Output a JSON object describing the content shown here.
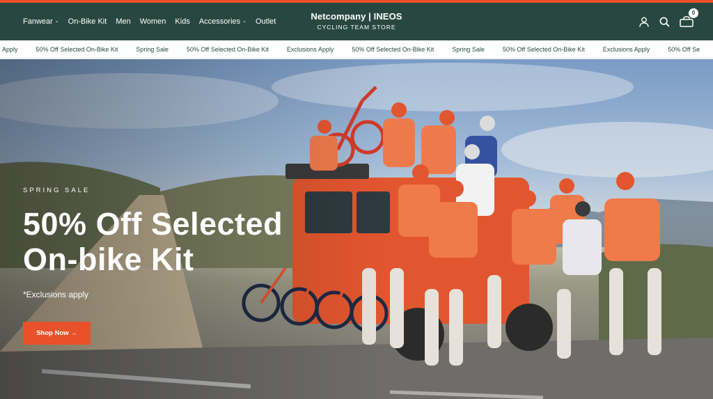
{
  "header": {
    "nav": [
      {
        "label": "Fanwear",
        "dropdown": true
      },
      {
        "label": "On-Bike Kit",
        "dropdown": false
      },
      {
        "label": "Men",
        "dropdown": false
      },
      {
        "label": "Women",
        "dropdown": false
      },
      {
        "label": "Kids",
        "dropdown": false
      },
      {
        "label": "Accessories",
        "dropdown": true
      },
      {
        "label": "Outlet",
        "dropdown": false
      }
    ],
    "logo": {
      "main": "Netcompany | INEOS",
      "sub": "CYCLING TEAM STORE"
    },
    "icons": [
      "account-icon",
      "search-icon",
      "cart-icon"
    ],
    "cart_count": "0"
  },
  "ticker": {
    "items": [
      "Apply",
      "50% Off Selected On-Bike Kit",
      "Spring Sale",
      "50% Off Selected On-Bike Kit",
      "Exclusions Apply",
      "50% Off Selected On-Bike Kit",
      "Spring Sale",
      "50% Off Selected On-Bike Kit",
      "Exclusions Apply",
      "50% Off Se"
    ]
  },
  "hero": {
    "eyebrow": "SPRING SALE",
    "headline_line1": "50% Off Selected",
    "headline_line2": "On-bike Kit",
    "subtext": "*Exclusions apply",
    "cta_label": "Shop Now →"
  },
  "colors": {
    "header_bg": "#28483f",
    "accent": "#e8512a",
    "text_light": "#ffffff"
  }
}
